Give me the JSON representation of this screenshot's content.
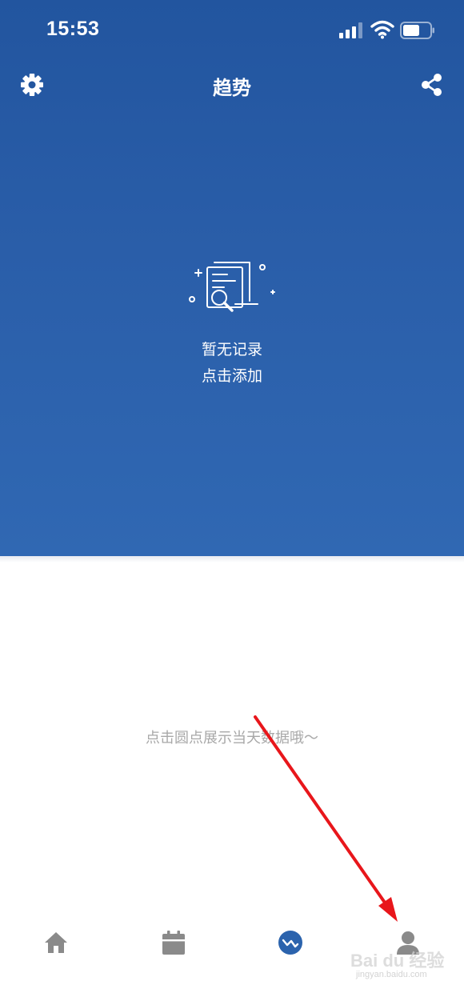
{
  "status_bar": {
    "time": "15:53",
    "signal_icon": "cellular-signal-icon",
    "wifi_icon": "wifi-icon",
    "battery_icon": "battery-icon"
  },
  "nav": {
    "title": "趋势",
    "left_icon": "gear-icon",
    "right_icon": "share-icon"
  },
  "empty_state": {
    "icon": "document-search-icon",
    "line1": "暂无记录",
    "line2": "点击添加"
  },
  "hint": "点击圆点展示当天数据哦～",
  "tabs": [
    {
      "icon": "home-icon",
      "active": false
    },
    {
      "icon": "calendar-icon",
      "active": false
    },
    {
      "icon": "trend-icon",
      "active": true
    },
    {
      "icon": "person-icon",
      "active": false
    }
  ],
  "watermark": {
    "text": "Bai du 经验",
    "url": "jingyan.baidu.com"
  },
  "colors": {
    "header_top": "#22559f",
    "header_bottom": "#3068b3",
    "tab_active": "#2b63ad",
    "tab_inactive": "#8a8a8a",
    "hint": "#a8a8a8",
    "arrow": "#e8161b"
  }
}
